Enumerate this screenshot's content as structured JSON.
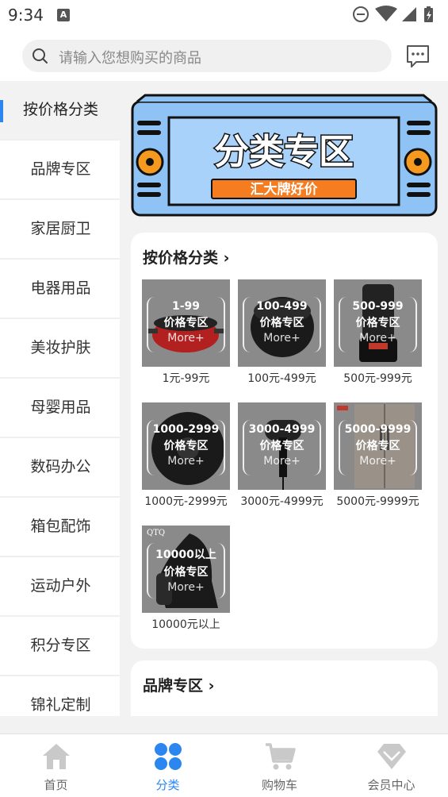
{
  "status_bar": {
    "time": "9:34",
    "notification_icon": "A"
  },
  "search": {
    "placeholder": "请输入您想购买的商品"
  },
  "sidebar": {
    "items": [
      {
        "label": "按价格分类",
        "active": true
      },
      {
        "label": "品牌专区"
      },
      {
        "label": "家居厨卫"
      },
      {
        "label": "电器用品"
      },
      {
        "label": "美妆护肤"
      },
      {
        "label": "母婴用品"
      },
      {
        "label": "数码办公"
      },
      {
        "label": "箱包配饰"
      },
      {
        "label": "运动户外"
      },
      {
        "label": "积分专区"
      },
      {
        "label": "锦礼定制"
      }
    ]
  },
  "banner": {
    "title": "分类专区",
    "subtitle": "汇大牌好价"
  },
  "sections": [
    {
      "title": "按价格分类",
      "items": [
        {
          "caption": "1元-99元",
          "tag_range": "1-99",
          "tag_label": "价格专区",
          "tag_more": "More+"
        },
        {
          "caption": "100元-499元",
          "tag_range": "100-499",
          "tag_label": "价格专区",
          "tag_more": "More+"
        },
        {
          "caption": "500元-999元",
          "tag_range": "500-999",
          "tag_label": "价格专区",
          "tag_more": "More+"
        },
        {
          "caption": "1000元-2999元",
          "tag_range": "1000-2999",
          "tag_label": "价格专区",
          "tag_more": "More+"
        },
        {
          "caption": "3000元-4999元",
          "tag_range": "3000-4999",
          "tag_label": "价格专区",
          "tag_more": "More+"
        },
        {
          "caption": "5000元-9999元",
          "tag_range": "5000-9999",
          "tag_label": "价格专区",
          "tag_more": "More+"
        },
        {
          "caption": "10000元以上",
          "tag_range": "10000以上",
          "tag_label": "价格专区",
          "tag_more": "More+",
          "brand": "QTQ"
        }
      ]
    },
    {
      "title": "品牌专区"
    }
  ],
  "bottom_nav": [
    {
      "label": "首页",
      "icon": "home-icon"
    },
    {
      "label": "分类",
      "icon": "category-icon",
      "active": true
    },
    {
      "label": "购物车",
      "icon": "cart-icon"
    },
    {
      "label": "会员中心",
      "icon": "member-icon"
    }
  ],
  "colors": {
    "accent": "#2b86f0",
    "banner_bg": "#8fc3f5",
    "banner_label": "#f57c1f"
  }
}
